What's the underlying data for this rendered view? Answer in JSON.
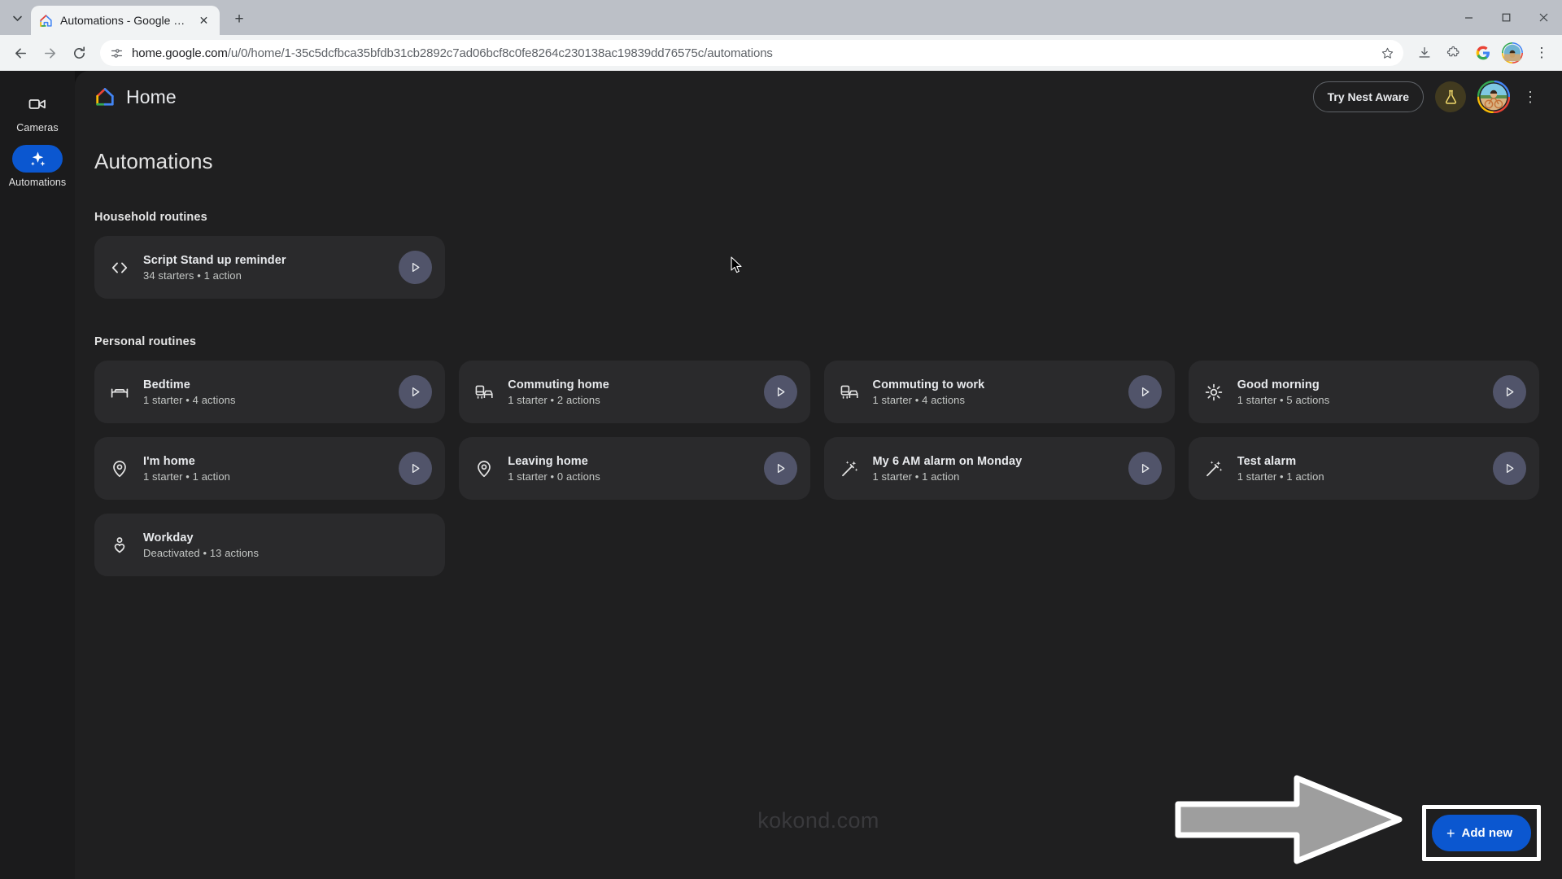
{
  "browser": {
    "tab": {
      "title": "Automations - Google Home",
      "favicon": "google-home-favicon",
      "close": "✕"
    },
    "new_tab_label": "+",
    "tabstrip_chevron": "⌄",
    "window_controls": {
      "minimize": "─",
      "maximize": "□",
      "close": "✕"
    },
    "nav": {
      "back": "←",
      "forward": "→",
      "reload": "↻"
    },
    "omnibox": {
      "site_settings_icon": "tune-icon",
      "host": "home.google.com",
      "path": "/u/0/home/1-35c5dcfbca35bfdb31cb2892c7ad06bcf8c0fe8264c230138ac19839dd76575c/automations",
      "full_url": "home.google.com/u/0/home/1-35c5dcfbca35bfdb31cb2892c7ad06bcf8c0fe8264c230138ac19839dd76575c/automations",
      "bookmark_icon": "star-icon",
      "download_icon": "download-icon",
      "extensions_icon": "puzzle-icon",
      "google_icon": "G",
      "profile_icon": "avatar",
      "menu_icon": "⋮"
    }
  },
  "app": {
    "logo": "google-home-logo",
    "title": "Home",
    "nest_aware_button": "Try Nest Aware",
    "labs_icon": "flask-icon",
    "avatar": "user-avatar",
    "overflow_menu": "⋮"
  },
  "sidebar": {
    "items": [
      {
        "label": "Cameras",
        "icon": "video-camera-icon",
        "active": false
      },
      {
        "label": "Automations",
        "icon": "sparkle-icon",
        "active": true
      }
    ]
  },
  "page": {
    "heading": "Automations",
    "sections": [
      {
        "title": "Household routines",
        "cards": [
          {
            "name": "Script Stand up reminder",
            "sub": "34 starters • 1 action",
            "icon": "code-brackets-icon",
            "play": true
          }
        ]
      },
      {
        "title": "Personal routines",
        "cards": [
          {
            "name": "Bedtime",
            "sub": "1 starter • 4 actions",
            "icon": "bed-icon",
            "play": true
          },
          {
            "name": "Commuting home",
            "sub": "1 starter • 2 actions",
            "icon": "commute-icon",
            "play": true
          },
          {
            "name": "Commuting to work",
            "sub": "1 starter • 4 actions",
            "icon": "commute-icon",
            "play": true
          },
          {
            "name": "Good morning",
            "sub": "1 starter • 5 actions",
            "icon": "sun-icon",
            "play": true
          },
          {
            "name": "I'm home",
            "sub": "1 starter • 1 action",
            "icon": "location-pin-icon",
            "play": true
          },
          {
            "name": "Leaving home",
            "sub": "1 starter • 0 actions",
            "icon": "location-pin-icon",
            "play": true
          },
          {
            "name": "My 6 AM alarm on Monday",
            "sub": "1 starter • 1 action",
            "icon": "magic-wand-icon",
            "play": true
          },
          {
            "name": "Test alarm",
            "sub": "1 starter • 1 action",
            "icon": "magic-wand-icon",
            "play": true
          },
          {
            "name": "Workday",
            "sub": "Deactivated • 13 actions",
            "icon": "person-heart-icon",
            "play": false
          }
        ]
      }
    ],
    "watermark": "kokond.com",
    "add_new_button": {
      "label": "Add new",
      "plus": "+"
    }
  },
  "colors": {
    "accent": "#0b57d0",
    "card_bg": "#2a2a2c",
    "page_bg": "#1f1f20",
    "rail_bg": "#1b1b1c",
    "play_bg": "#51546a",
    "text_primary": "#e8eaed",
    "text_secondary": "#c4c7c5",
    "annotation_arrow": "#9e9e9e",
    "annotation_border": "#ffffff"
  }
}
